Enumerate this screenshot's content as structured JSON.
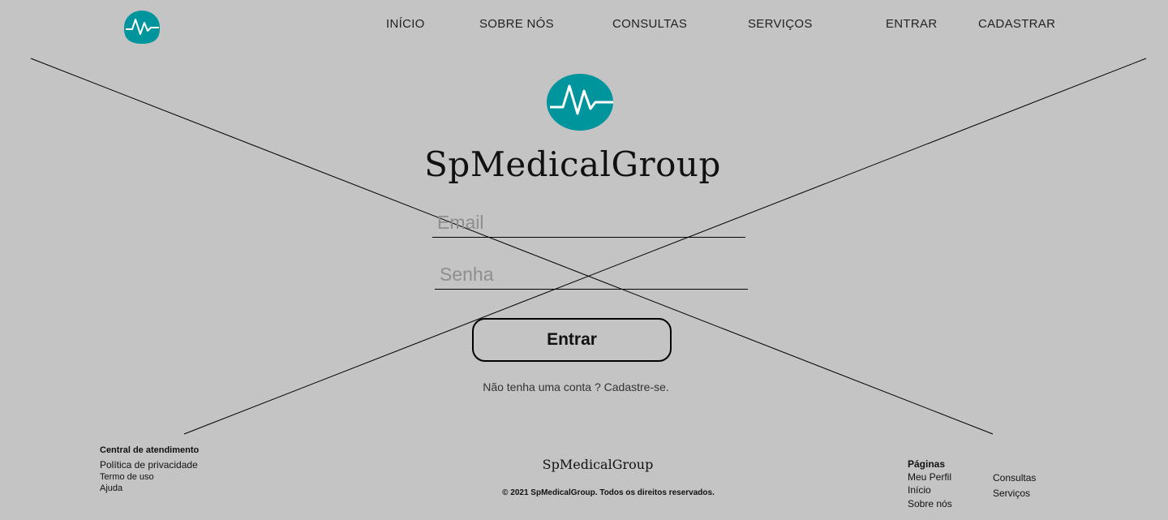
{
  "colors": {
    "background": "#c4c4c4",
    "accent": "#00949c"
  },
  "nav": {
    "logo_icon": "heartbeat-logo-icon",
    "items": [
      {
        "label": "INÍCIO"
      },
      {
        "label": "SOBRE NÓS"
      },
      {
        "label": "CONSULTAS"
      },
      {
        "label": "SERVIÇOS"
      },
      {
        "label": "ENTRAR"
      },
      {
        "label": "CADASTRAR"
      }
    ]
  },
  "hero": {
    "logo_icon": "heartbeat-logo-icon",
    "brand": "SpMedicalGroup"
  },
  "form": {
    "email_placeholder": "Email",
    "email_value": "",
    "senha_placeholder": "Senha",
    "senha_value": "",
    "submit_label": "Entrar",
    "signup_text": "Não tenha uma conta ? Cadastre-se."
  },
  "footer": {
    "left": {
      "heading": "Central de atendimento",
      "links": [
        "Política de privacidade",
        "Termo de uso",
        "Ajuda"
      ]
    },
    "brand": "SpMedicalGroup",
    "copyright": "© 2021 SpMedicalGroup. Todos os direitos reservados.",
    "pages": {
      "heading": "Páginas",
      "col1": [
        "Meu Perfil",
        "Início",
        "Sobre nós"
      ],
      "col2": [
        "Consultas",
        "Serviços"
      ]
    }
  }
}
